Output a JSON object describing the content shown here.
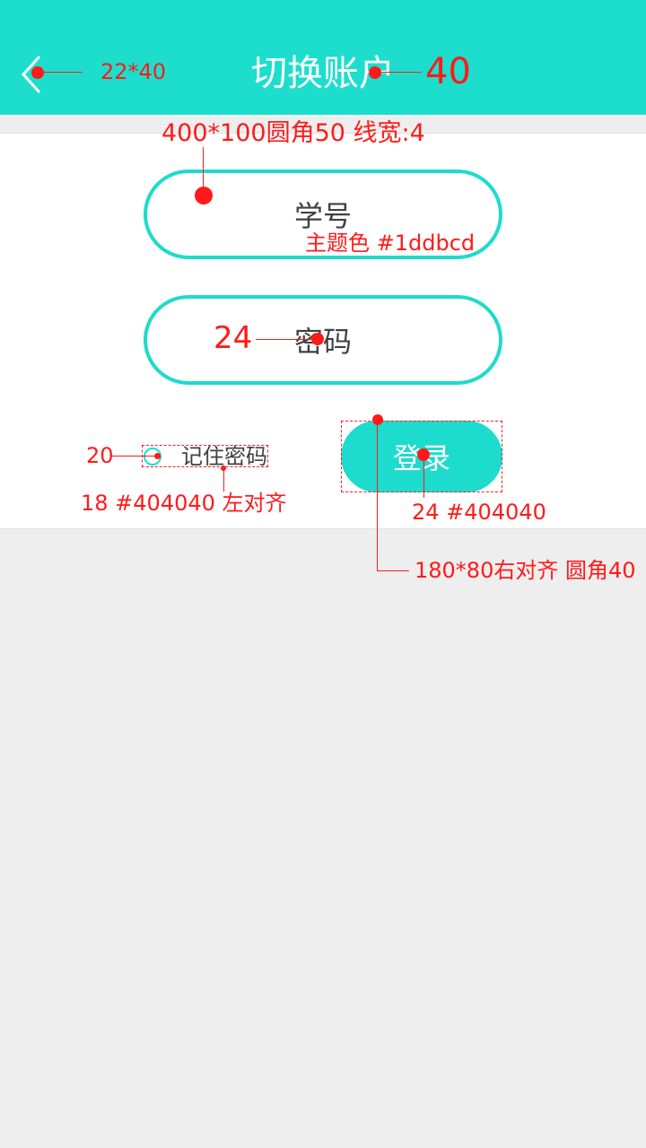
{
  "header": {
    "title": "切换账户",
    "background": "#1ddecd"
  },
  "form": {
    "student_id_placeholder": "学号",
    "password_placeholder": "密码",
    "remember_label": "记住密码",
    "login_label": "登录"
  },
  "theme": {
    "main_color": "#1ddbcd",
    "text_color": "#404040"
  },
  "annotations": {
    "back_size": "22*40",
    "title_size": "40",
    "field_spec": "400*100圆角50 线宽:4",
    "theme_color": "主题色 #1ddbcd",
    "field_font": "24",
    "circle_size": "20",
    "remember_font": "18 #404040 左对齐",
    "login_font": "24 #404040",
    "login_spec": "180*80右对齐 圆角40"
  }
}
